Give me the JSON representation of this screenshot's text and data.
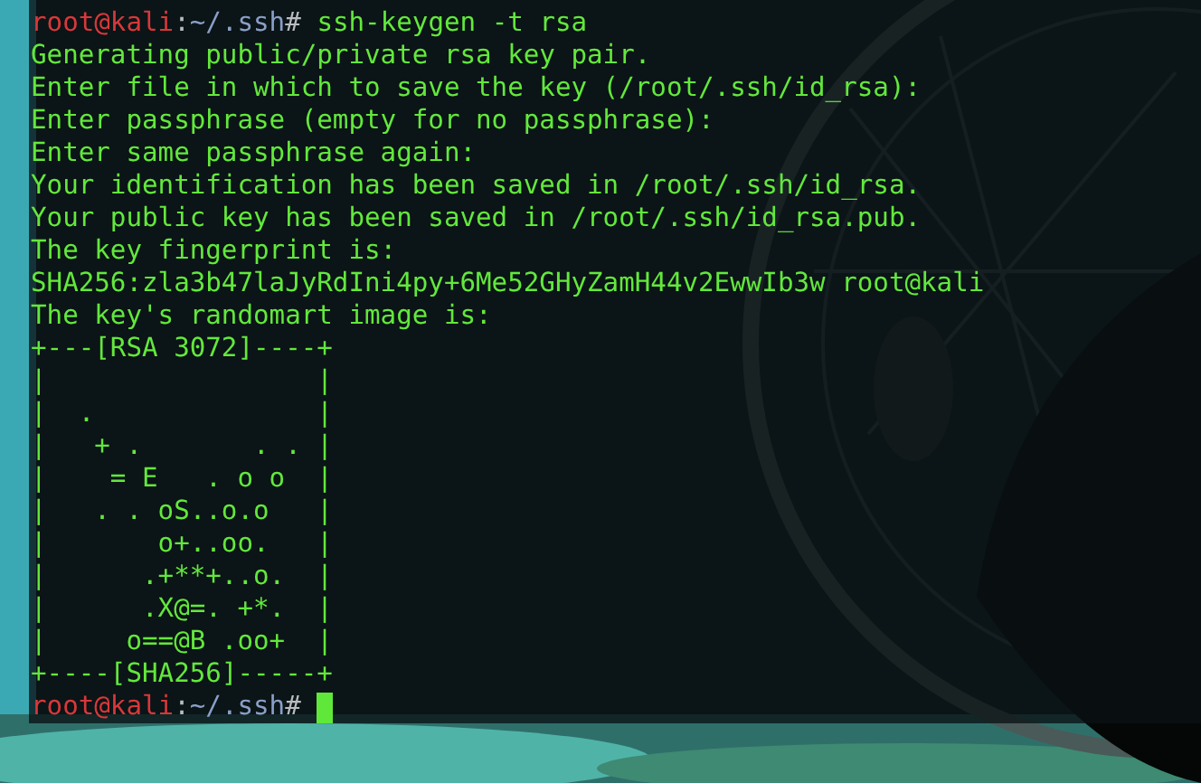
{
  "terminal": {
    "lines": [
      {
        "kind": "prompt",
        "user": "root@kali",
        "separator": ":",
        "path": "~/.ssh",
        "symbol": "#",
        "command": "ssh-keygen -t rsa",
        "cursor": false
      },
      {
        "kind": "output",
        "text": "Generating public/private rsa key pair."
      },
      {
        "kind": "output",
        "text": "Enter file in which to save the key (/root/.ssh/id_rsa):"
      },
      {
        "kind": "output",
        "text": "Enter passphrase (empty for no passphrase):"
      },
      {
        "kind": "output",
        "text": "Enter same passphrase again:"
      },
      {
        "kind": "output",
        "text": "Your identification has been saved in /root/.ssh/id_rsa."
      },
      {
        "kind": "output",
        "text": "Your public key has been saved in /root/.ssh/id_rsa.pub."
      },
      {
        "kind": "output",
        "text": "The key fingerprint is:"
      },
      {
        "kind": "output",
        "text": "SHA256:zla3b47laJyRdIni4py+6Me52GHyZamH44v2EwwIb3w root@kali"
      },
      {
        "kind": "output",
        "text": "The key's randomart image is:"
      },
      {
        "kind": "output",
        "text": "+---[RSA 3072]----+"
      },
      {
        "kind": "output",
        "text": "|                 |"
      },
      {
        "kind": "output",
        "text": "|  .              |"
      },
      {
        "kind": "output",
        "text": "|   + .       . . |"
      },
      {
        "kind": "output",
        "text": "|    = E   . o o  |"
      },
      {
        "kind": "output",
        "text": "|   . . oS..o.o   |"
      },
      {
        "kind": "output",
        "text": "|       o+..oo.   |"
      },
      {
        "kind": "output",
        "text": "|      .+**+..o.  |"
      },
      {
        "kind": "output",
        "text": "|      .X@=. +*.  |"
      },
      {
        "kind": "output",
        "text": "|     o==@B .oo+  |"
      },
      {
        "kind": "output",
        "text": "+----[SHA256]-----+"
      },
      {
        "kind": "prompt",
        "user": "root@kali",
        "separator": ":",
        "path": "~/.ssh",
        "symbol": "#",
        "cursor": true
      }
    ]
  }
}
